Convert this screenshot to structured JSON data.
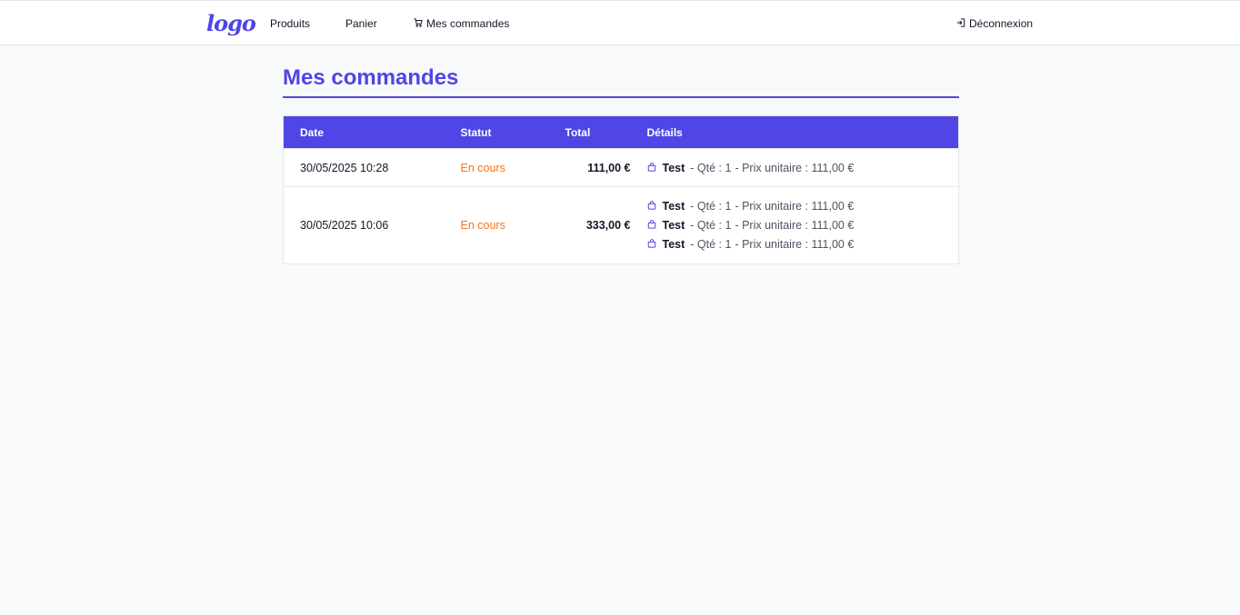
{
  "nav": {
    "logo": "logo",
    "links": [
      {
        "label": "Produits"
      },
      {
        "label": "Panier"
      },
      {
        "label": "Mes commandes",
        "icon": "cart-icon"
      }
    ],
    "logout": {
      "label": "Déconnexion",
      "icon": "logout-icon"
    }
  },
  "page": {
    "title": "Mes commandes"
  },
  "table": {
    "headers": {
      "date": "Date",
      "status": "Statut",
      "total": "Total",
      "details": "Détails"
    },
    "rows": [
      {
        "date": "30/05/2025 10:28",
        "status": "En cours",
        "total": "111,00 €",
        "items": [
          {
            "name": "Test",
            "qty": "- Qté : 1",
            "price": "- Prix unitaire : 111,00 €"
          }
        ]
      },
      {
        "date": "30/05/2025 10:06",
        "status": "En cours",
        "total": "333,00 €",
        "items": [
          {
            "name": "Test",
            "qty": "- Qté : 1",
            "price": "- Prix unitaire : 111,00 €"
          },
          {
            "name": "Test",
            "qty": "- Qté : 1",
            "price": "- Prix unitaire : 111,00 €"
          },
          {
            "name": "Test",
            "qty": "- Qté : 1",
            "price": "- Prix unitaire : 111,00 €"
          }
        ]
      }
    ]
  },
  "colors": {
    "accent": "#4f46e5",
    "status": "#f97316",
    "background": "#f8f9fa"
  }
}
